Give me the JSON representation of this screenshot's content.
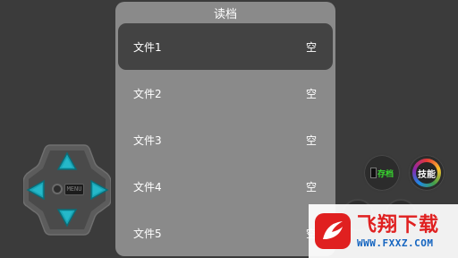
{
  "dialog": {
    "title": "读档",
    "slots": [
      {
        "name": "文件1",
        "status": "空"
      },
      {
        "name": "文件2",
        "status": "空"
      },
      {
        "name": "文件3",
        "status": "空"
      },
      {
        "name": "文件4",
        "status": "空"
      },
      {
        "name": "文件5",
        "status": "空"
      }
    ],
    "selected_index": 0
  },
  "dpad": {
    "center_label": "MENU",
    "accent_color": "#1aa6b7"
  },
  "buttons": {
    "save_label": "存档",
    "skill_label": "技能"
  },
  "watermark": {
    "title": "飞翔下载",
    "url": "WWW.FXXZ.COM"
  },
  "colors": {
    "background": "#3b3b3b",
    "dialog": "#8a8a8a",
    "selected_row": "#434343"
  }
}
